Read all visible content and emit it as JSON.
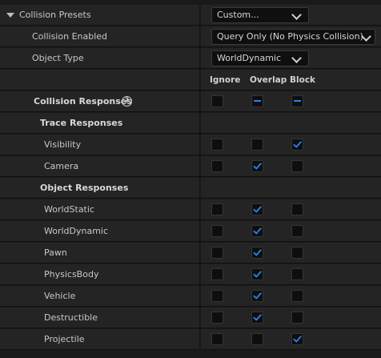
{
  "presets": {
    "label": "Collision Presets",
    "value": "Custom..."
  },
  "collision_enabled": {
    "label": "Collision Enabled",
    "value": "Query Only (No Physics Collision)"
  },
  "object_type": {
    "label": "Object Type",
    "value": "WorldDynamic"
  },
  "columns": {
    "ignore": "Ignore",
    "overlap": "Overlap",
    "block": "Block"
  },
  "responses": {
    "label": "Collision Responses",
    "help_glyph": "?",
    "state": "mixed-overlap-block"
  },
  "trace": {
    "label": "Trace Responses",
    "items": [
      {
        "label": "Visibility",
        "ignore": false,
        "overlap": false,
        "block": true
      },
      {
        "label": "Camera",
        "ignore": false,
        "overlap": true,
        "block": false
      }
    ]
  },
  "object": {
    "label": "Object Responses",
    "items": [
      {
        "label": "WorldStatic",
        "ignore": false,
        "overlap": true,
        "block": false
      },
      {
        "label": "WorldDynamic",
        "ignore": false,
        "overlap": true,
        "block": false
      },
      {
        "label": "Pawn",
        "ignore": false,
        "overlap": true,
        "block": false
      },
      {
        "label": "PhysicsBody",
        "ignore": false,
        "overlap": true,
        "block": false
      },
      {
        "label": "Vehicle",
        "ignore": false,
        "overlap": true,
        "block": false
      },
      {
        "label": "Destructible",
        "ignore": false,
        "overlap": true,
        "block": false
      },
      {
        "label": "Projectile",
        "ignore": false,
        "overlap": false,
        "block": true
      }
    ]
  },
  "colors": {
    "accent": "#2f7fe6",
    "background": "#242424"
  }
}
